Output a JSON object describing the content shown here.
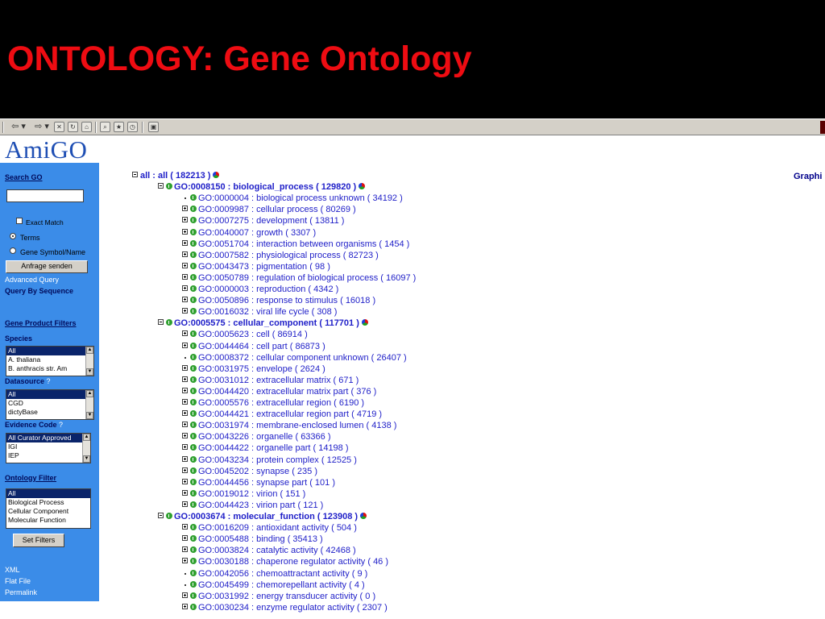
{
  "slide": {
    "title": "ONTOLOGY: Gene Ontology"
  },
  "colors": {
    "title_bg": "#000000",
    "title_text": "#ee0c12",
    "sidebar_bg": "#3b8ce8",
    "tree_link": "#1e1ec8"
  },
  "toolbar": {
    "back_glyph": "⇦ ▾",
    "forward_glyph": "⇨ ▾",
    "icons": [
      "stop-icon",
      "refresh-icon",
      "home-icon",
      "search-icon",
      "favorites-icon",
      "history-icon",
      "fullscreen-icon"
    ]
  },
  "logo": {
    "text": "AmiGO"
  },
  "sidebar": {
    "search_heading": "Search GO",
    "search_value": "",
    "exact_match_label": "Exact Match",
    "terms_label": "Terms",
    "gene_symbol_label": "Gene Symbol/Name",
    "submit_label": "Anfrage senden",
    "advanced_query": "Advanced Query",
    "query_by_sequence": "Query By Sequence",
    "gene_product_filters": "Gene Product Filters",
    "species_label": "Species",
    "species_options": [
      "All",
      "A. thaliana",
      "B. anthracis str. Am"
    ],
    "datasource_label": "Datasource",
    "datasource_help": "?",
    "datasource_options": [
      "All",
      "CGD",
      "dictyBase"
    ],
    "evidence_label": "Evidence Code",
    "evidence_help": "?",
    "evidence_options": [
      "All Curator Approved",
      "IGI",
      "IEP"
    ],
    "ontology_filter": "Ontology Filter",
    "ontology_options": [
      "All",
      "Biological Process",
      "Cellular Component",
      "Molecular Function"
    ],
    "set_filters_label": "Set Filters",
    "xml": "XML",
    "flat_file": "Flat File",
    "permalink": "Permalink"
  },
  "graph_link": "Graphi",
  "tree": [
    {
      "text": "all : all ( 182213 )",
      "level": 0,
      "toggle": "minus",
      "ball": true
    },
    {
      "text": "GO:0008150 : biological_process ( 129820 )",
      "level": 1,
      "toggle": "minus",
      "ball": true
    },
    {
      "text": "GO:0000004 : biological process unknown ( 34192 )",
      "level": 2,
      "toggle": "dot"
    },
    {
      "text": "GO:0009987 : cellular process ( 80269 )",
      "level": 2,
      "toggle": "plus"
    },
    {
      "text": "GO:0007275 : development ( 13811 )",
      "level": 2,
      "toggle": "plus"
    },
    {
      "text": "GO:0040007 : growth ( 3307 )",
      "level": 2,
      "toggle": "plus"
    },
    {
      "text": "GO:0051704 : interaction between organisms ( 1454 )",
      "level": 2,
      "toggle": "plus"
    },
    {
      "text": "GO:0007582 : physiological process ( 82723 )",
      "level": 2,
      "toggle": "plus"
    },
    {
      "text": "GO:0043473 : pigmentation ( 98 )",
      "level": 2,
      "toggle": "plus"
    },
    {
      "text": "GO:0050789 : regulation of biological process ( 16097 )",
      "level": 2,
      "toggle": "plus"
    },
    {
      "text": "GO:0000003 : reproduction ( 4342 )",
      "level": 2,
      "toggle": "plus"
    },
    {
      "text": "GO:0050896 : response to stimulus ( 16018 )",
      "level": 2,
      "toggle": "plus"
    },
    {
      "text": "GO:0016032 : viral life cycle ( 308 )",
      "level": 2,
      "toggle": "plus"
    },
    {
      "text": "GO:0005575 : cellular_component ( 117701 )",
      "level": 1,
      "toggle": "minus",
      "ball": true
    },
    {
      "text": "GO:0005623 : cell ( 86914 )",
      "level": 2,
      "toggle": "plus"
    },
    {
      "text": "GO:0044464 : cell part ( 86873 )",
      "level": 2,
      "toggle": "plus"
    },
    {
      "text": "GO:0008372 : cellular component unknown ( 26407 )",
      "level": 2,
      "toggle": "dot"
    },
    {
      "text": "GO:0031975 : envelope ( 2624 )",
      "level": 2,
      "toggle": "plus"
    },
    {
      "text": "GO:0031012 : extracellular matrix ( 671 )",
      "level": 2,
      "toggle": "plus"
    },
    {
      "text": "GO:0044420 : extracellular matrix part ( 376 )",
      "level": 2,
      "toggle": "plus"
    },
    {
      "text": "GO:0005576 : extracellular region ( 6190 )",
      "level": 2,
      "toggle": "plus"
    },
    {
      "text": "GO:0044421 : extracellular region part ( 4719 )",
      "level": 2,
      "toggle": "plus"
    },
    {
      "text": "GO:0031974 : membrane-enclosed lumen ( 4138 )",
      "level": 2,
      "toggle": "plus"
    },
    {
      "text": "GO:0043226 : organelle ( 63366 )",
      "level": 2,
      "toggle": "plus"
    },
    {
      "text": "GO:0044422 : organelle part ( 14198 )",
      "level": 2,
      "toggle": "plus"
    },
    {
      "text": "GO:0043234 : protein complex ( 12525 )",
      "level": 2,
      "toggle": "plus"
    },
    {
      "text": "GO:0045202 : synapse ( 235 )",
      "level": 2,
      "toggle": "plus"
    },
    {
      "text": "GO:0044456 : synapse part ( 101 )",
      "level": 2,
      "toggle": "plus"
    },
    {
      "text": "GO:0019012 : virion ( 151 )",
      "level": 2,
      "toggle": "plus"
    },
    {
      "text": "GO:0044423 : virion part ( 121 )",
      "level": 2,
      "toggle": "plus"
    },
    {
      "text": "GO:0003674 : molecular_function ( 123908 )",
      "level": 1,
      "toggle": "minus",
      "ball": true
    },
    {
      "text": "GO:0016209 : antioxidant activity ( 504 )",
      "level": 2,
      "toggle": "plus"
    },
    {
      "text": "GO:0005488 : binding ( 35413 )",
      "level": 2,
      "toggle": "plus"
    },
    {
      "text": "GO:0003824 : catalytic activity ( 42468 )",
      "level": 2,
      "toggle": "plus"
    },
    {
      "text": "GO:0030188 : chaperone regulator activity ( 46 )",
      "level": 2,
      "toggle": "plus"
    },
    {
      "text": "GO:0042056 : chemoattractant activity ( 9 )",
      "level": 2,
      "toggle": "dot"
    },
    {
      "text": "GO:0045499 : chemorepellant activity ( 4 )",
      "level": 2,
      "toggle": "dot"
    },
    {
      "text": "GO:0031992 : energy transducer activity ( 0 )",
      "level": 2,
      "toggle": "plus"
    },
    {
      "text": "GO:0030234 : enzyme regulator activity ( 2307 )",
      "level": 2,
      "toggle": "plus"
    }
  ]
}
